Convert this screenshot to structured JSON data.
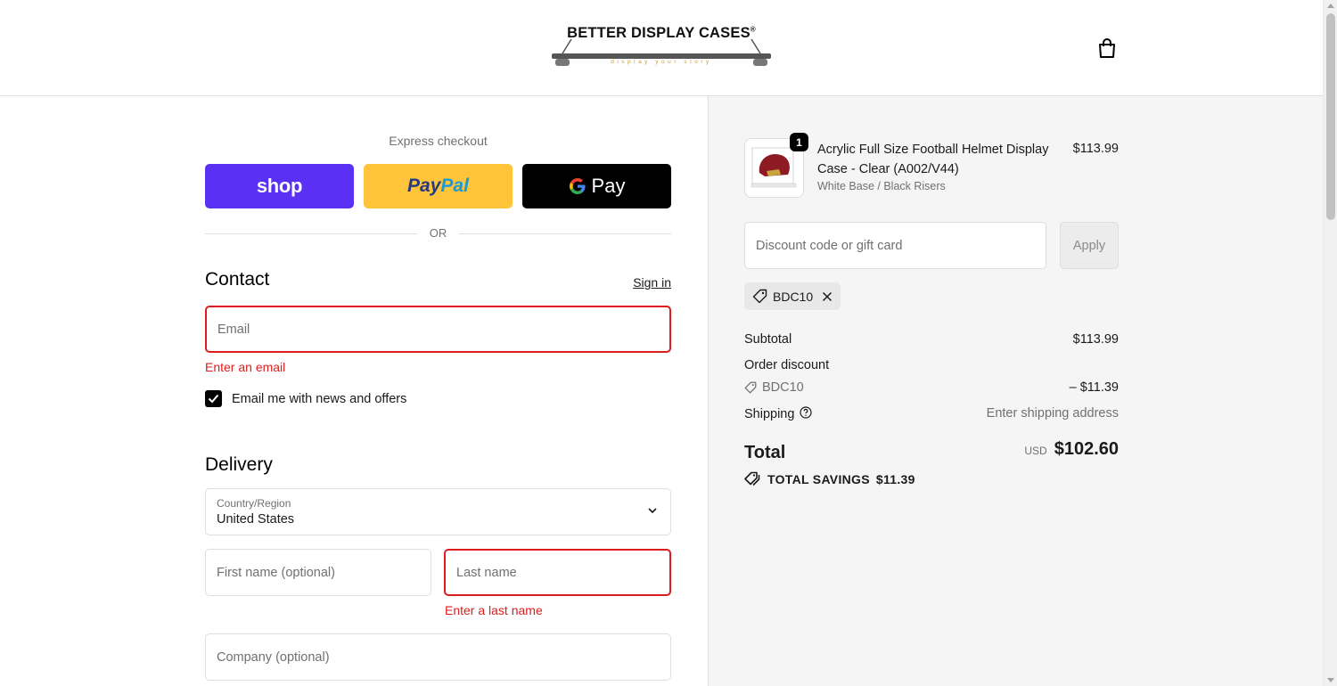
{
  "header": {
    "logo_text": "BETTER DISPLAY CASES",
    "logo_registered": "®",
    "logo_tagline": "display your story",
    "cart_icon": "shopping-bag-icon"
  },
  "express": {
    "title": "Express checkout",
    "shop_label": "shop",
    "paypal_label_a": "Pay",
    "paypal_label_b": "Pal",
    "gpay_label": "Pay",
    "or_text": "OR"
  },
  "contact": {
    "heading": "Contact",
    "signin": "Sign in",
    "email_placeholder": "Email",
    "email_value": "",
    "email_error": "Enter an email",
    "news_label": "Email me with news and offers",
    "news_checked": true
  },
  "delivery": {
    "heading": "Delivery",
    "country_label": "Country/Region",
    "country_value": "United States",
    "first_name_placeholder": "First name (optional)",
    "last_name_placeholder": "Last name",
    "last_name_error": "Enter a last name",
    "company_placeholder": "Company (optional)"
  },
  "cart": {
    "item": {
      "quantity": "1",
      "name": "Acrylic Full Size Football Helmet Display Case - Clear (A002/V44)",
      "variant": "White Base / Black Risers",
      "price": "$113.99"
    },
    "discount_placeholder": "Discount code or gift card",
    "apply_label": "Apply",
    "applied_code": "BDC10"
  },
  "summary": {
    "subtotal_label": "Subtotal",
    "subtotal_value": "$113.99",
    "order_discount_label": "Order discount",
    "discount_code": "BDC10",
    "discount_value": "– $11.39",
    "shipping_label": "Shipping",
    "shipping_value": "Enter shipping address",
    "total_label": "Total",
    "total_currency": "USD",
    "total_value": "$102.60",
    "savings_label": "TOTAL SAVINGS",
    "savings_value": "$11.39"
  },
  "colors": {
    "shop_purple": "#5a31f4",
    "paypal_yellow": "#ffc439",
    "error_red": "#dd1d1d",
    "sidebar_bg": "#f5f5f5"
  }
}
